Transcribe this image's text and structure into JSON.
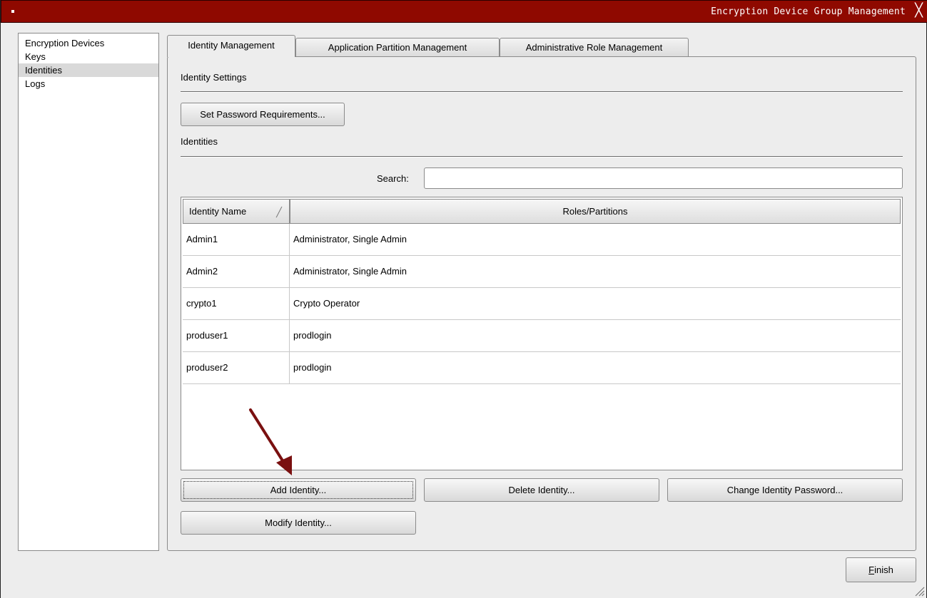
{
  "window": {
    "title": "Encryption Device Group Management",
    "accent": "#8f0900"
  },
  "nav": {
    "items": [
      {
        "label": "Encryption Devices",
        "selected": false
      },
      {
        "label": "Keys",
        "selected": false
      },
      {
        "label": "Identities",
        "selected": true
      },
      {
        "label": "Logs",
        "selected": false
      }
    ]
  },
  "tabs": [
    {
      "label": "Identity Management",
      "active": true
    },
    {
      "label": "Application Partition Management",
      "active": false
    },
    {
      "label": "Administrative Role Management",
      "active": false
    }
  ],
  "identity_settings": {
    "heading": "Identity Settings",
    "password_button": "Set Password Requirements..."
  },
  "identities": {
    "heading": "Identities",
    "search_label": "Search:",
    "search_value": "",
    "columns": [
      "Identity Name",
      "Roles/Partitions"
    ],
    "sort_glyph": "╱",
    "rows": [
      {
        "name": "Admin1",
        "roles": "Administrator, Single Admin"
      },
      {
        "name": "Admin2",
        "roles": "Administrator, Single Admin"
      },
      {
        "name": "crypto1",
        "roles": "Crypto Operator"
      },
      {
        "name": "produser1",
        "roles": "prodlogin"
      },
      {
        "name": "produser2",
        "roles": "prodlogin"
      }
    ]
  },
  "actions": {
    "add": "Add Identity...",
    "delete": "Delete Identity...",
    "change_password": "Change Identity Password...",
    "modify": "Modify Identity..."
  },
  "footer": {
    "finish_prefix": "",
    "finish_mnemonic": "F",
    "finish_rest": "inish"
  },
  "icons": {
    "close": "close-icon",
    "sort": "sort-indicator-icon",
    "annotation": "arrow-annotation-icon",
    "grip": "resize-grip-icon"
  }
}
